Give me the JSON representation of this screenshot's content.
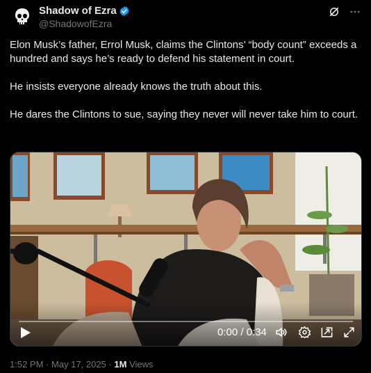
{
  "author": {
    "display_name": "Shadow of Ezra",
    "handle": "@ShadowofEzra"
  },
  "tweet": {
    "text": "Elon Musk’s father, Errol Musk, claims the Clintons’ “body count” exceeds a hundred and says he’s ready to defend his statement in court.\n\nHe insists everyone already knows the truth about this.\n\nHe dares the Clintons to sue, saying they never will never take him to court."
  },
  "video": {
    "time_display": "0:00 / 0:34",
    "progress": 0.0
  },
  "meta": {
    "time": "1:52 PM",
    "separator": "·",
    "date": "May 17, 2025",
    "views_count": "1M",
    "views_label": "Views"
  },
  "colors": {
    "background": "#000000",
    "text_primary": "#e7e9ea",
    "text_secondary": "#71767b",
    "verified": "#1d9bf0"
  },
  "icons": [
    "skull-avatar-icon",
    "verified-badge-icon",
    "grok-icon",
    "more-icon",
    "play-icon",
    "volume-icon",
    "settings-icon",
    "pip-icon",
    "fullscreen-icon"
  ]
}
